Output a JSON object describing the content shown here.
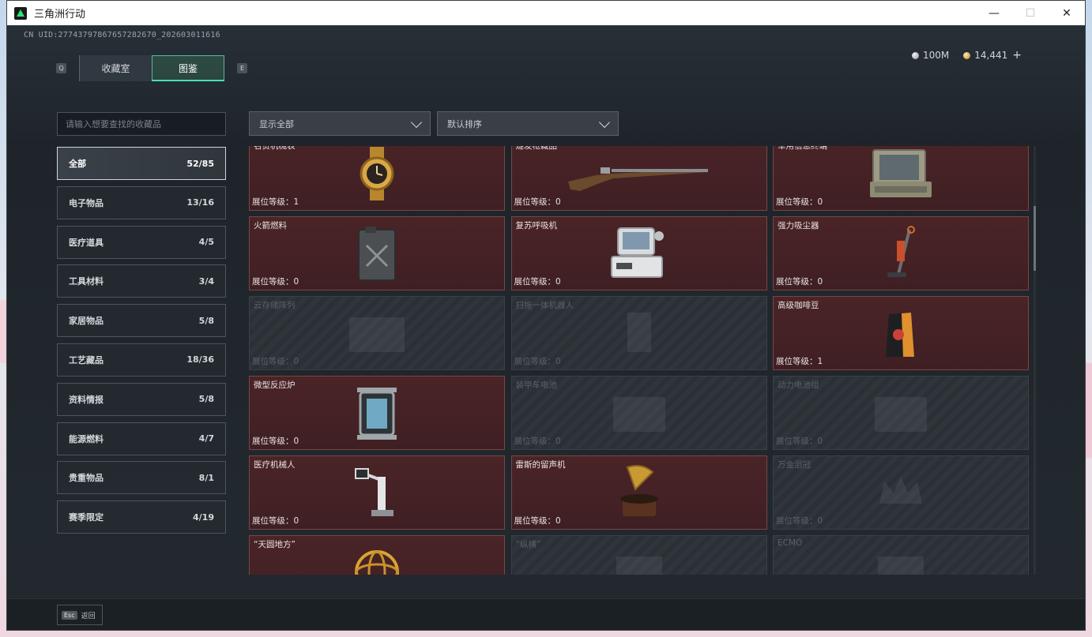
{
  "window": {
    "title": "三角洲行动",
    "controls": {
      "minimize": "—",
      "maximize": "☐",
      "close": "✕"
    }
  },
  "header": {
    "uid": "CN UID:27743797867657282670_202603011616",
    "currency": [
      {
        "icon": "silver-coin-icon",
        "value": "100M"
      },
      {
        "icon": "gold-coin-icon",
        "value": "14,441"
      }
    ],
    "add_label": "+"
  },
  "tabs": {
    "left_key": "Q",
    "right_key": "E",
    "items": [
      {
        "label": "收藏室",
        "active": false
      },
      {
        "label": "图鉴",
        "active": true
      }
    ]
  },
  "search": {
    "placeholder": "请输入想要查找的收藏品"
  },
  "filters": {
    "display": "显示全部",
    "sort": "默认排序"
  },
  "categories": [
    {
      "label": "全部",
      "count": "52/85",
      "active": true
    },
    {
      "label": "电子物品",
      "count": "13/16"
    },
    {
      "label": "医疗道具",
      "count": "4/5"
    },
    {
      "label": "工具材料",
      "count": "3/4"
    },
    {
      "label": "家居物品",
      "count": "5/8"
    },
    {
      "label": "工艺藏品",
      "count": "18/36"
    },
    {
      "label": "资料情报",
      "count": "5/8"
    },
    {
      "label": "能源燃料",
      "count": "4/7"
    },
    {
      "label": "贵重物品",
      "count": "8/1"
    },
    {
      "label": "赛季限定",
      "count": "4/19"
    }
  ],
  "items": [
    {
      "name": "名贵机械表",
      "level": "展位等级：1",
      "owned": true,
      "art": "watch"
    },
    {
      "name": "燧发枪藏品",
      "level": "展位等级：0",
      "owned": true,
      "art": "rifle"
    },
    {
      "name": "军用信息终端",
      "level": "展位等级：0",
      "owned": true,
      "art": "terminal"
    },
    {
      "name": "火箭燃料",
      "level": "展位等级：0",
      "owned": true,
      "art": "fuel"
    },
    {
      "name": "复苏呼吸机",
      "level": "展位等级：0",
      "owned": true,
      "art": "ventilator"
    },
    {
      "name": "强力吸尘器",
      "level": "展位等级：0",
      "owned": true,
      "art": "vacuum"
    },
    {
      "name": "云存储阵列",
      "level": "展位等级：0",
      "owned": false,
      "art": "server"
    },
    {
      "name": "扫拖一体机器人",
      "level": "展位等级：0",
      "owned": false,
      "art": "robot"
    },
    {
      "name": "高级咖啡豆",
      "level": "展位等级：1",
      "owned": true,
      "art": "coffee"
    },
    {
      "name": "微型反应炉",
      "level": "展位等级：0",
      "owned": true,
      "art": "reactor"
    },
    {
      "name": "装甲车电池",
      "level": "展位等级：0",
      "owned": false,
      "art": "battery"
    },
    {
      "name": "动力电池组",
      "level": "展位等级：0",
      "owned": false,
      "art": "battery"
    },
    {
      "name": "医疗机械人",
      "level": "展位等级：0",
      "owned": true,
      "art": "medbot"
    },
    {
      "name": "雷斯的留声机",
      "level": "展位等级：0",
      "owned": true,
      "art": "phonograph"
    },
    {
      "name": "万金泪冠",
      "level": "展位等级：0",
      "owned": false,
      "art": "crown"
    },
    {
      "name": "“天圆地方”",
      "level": "",
      "owned": true,
      "art": "armillary"
    },
    {
      "name": "“纵横”",
      "level": "",
      "owned": false,
      "art": "box"
    },
    {
      "name": "ECMO",
      "level": "",
      "owned": false,
      "art": "box"
    }
  ],
  "footer": {
    "esc_key": "Esc",
    "back_label": "返回"
  },
  "colors": {
    "accent": "#49e0b0",
    "owned_card": "#4a2427",
    "locked_card": "#2a3035"
  }
}
